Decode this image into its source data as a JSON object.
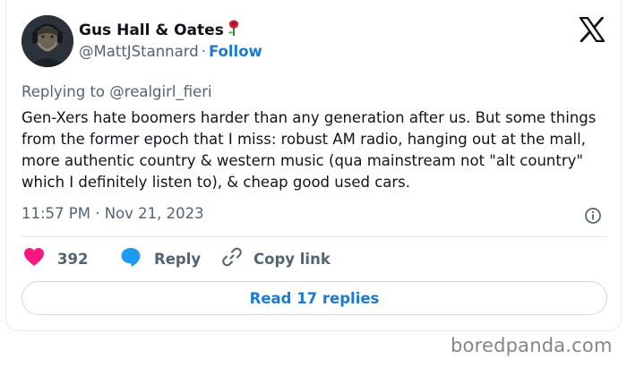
{
  "author": {
    "display_name": "Gus Hall & Oates",
    "emoji_icon": "rose-emoji",
    "handle": "@MattJStannard",
    "separator": "·",
    "follow_label": "Follow"
  },
  "reply_context": {
    "prefix": "Replying to",
    "mention": "@realgirl_fieri"
  },
  "tweet": {
    "text": "Gen-Xers hate boomers harder than any generation after us. But some things from the former epoch that I miss: robust AM radio, hanging out at the mall, more authentic country & western music (qua mainstream not \"alt country\" which I definitely listen to), & cheap good used cars.",
    "timestamp": "11:57 PM · Nov 21, 2023"
  },
  "actions": {
    "like_count": "392",
    "reply_label": "Reply",
    "copy_label": "Copy link",
    "read_replies_label": "Read 17 replies"
  },
  "watermark": "boredpanda.com",
  "colors": {
    "accent": "#1d7ad4",
    "like": "#f91880",
    "text": "#0f1419",
    "muted": "#536471"
  },
  "icons": [
    "x-logo-icon",
    "info-icon",
    "heart-icon",
    "reply-bubble-icon",
    "link-icon"
  ]
}
